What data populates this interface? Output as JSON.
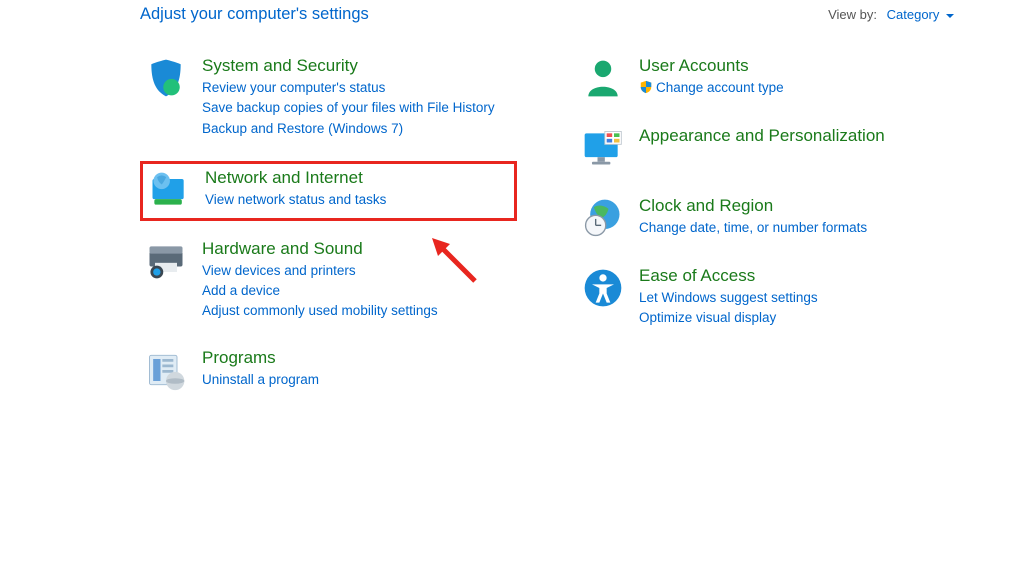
{
  "header": {
    "title": "Adjust your computer's settings",
    "viewby_label": "View by:",
    "viewby_value": "Category"
  },
  "left": [
    {
      "icon": "shield",
      "title": "System and Security",
      "links": [
        "Review your computer's status",
        "Save backup copies of your files with File History",
        "Backup and Restore (Windows 7)"
      ]
    },
    {
      "icon": "network",
      "title": "Network and Internet",
      "highlight": true,
      "links": [
        "View network status and tasks"
      ]
    },
    {
      "icon": "hardware",
      "title": "Hardware and Sound",
      "links": [
        "View devices and printers",
        "Add a device",
        "Adjust commonly used mobility settings"
      ]
    },
    {
      "icon": "programs",
      "title": "Programs",
      "links": [
        "Uninstall a program"
      ]
    }
  ],
  "right": [
    {
      "icon": "user",
      "title": "User Accounts",
      "links": [
        {
          "shield": true,
          "text": "Change account type"
        }
      ]
    },
    {
      "icon": "appearance",
      "title": "Appearance and Personalization",
      "links": []
    },
    {
      "icon": "clock",
      "title": "Clock and Region",
      "links": [
        "Change date, time, or number formats"
      ]
    },
    {
      "icon": "ease",
      "title": "Ease of Access",
      "links": [
        "Let Windows suggest settings",
        "Optimize visual display"
      ]
    }
  ]
}
